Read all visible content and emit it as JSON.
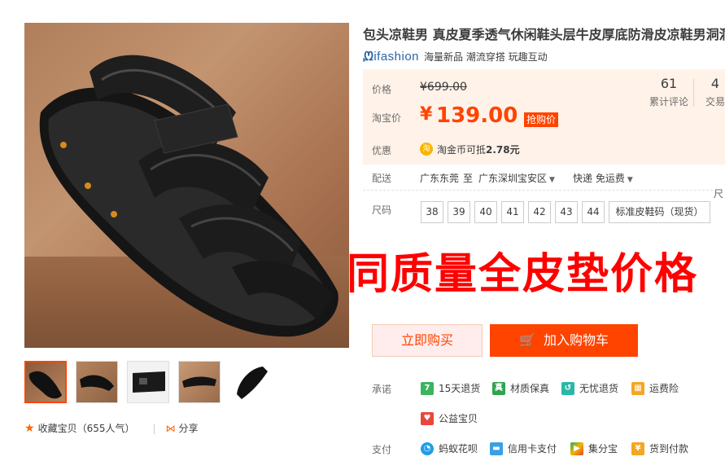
{
  "product": {
    "title": "包头凉鞋男 真皮夏季透气休闲鞋头层牛皮厚底防滑皮凉鞋男洞洞鞋",
    "brand_logo": "ifashion",
    "brand_tags": "海量新品 潮流穿搭 玩趣互动"
  },
  "price": {
    "orig_label": "价格",
    "orig_value": "¥699.00",
    "sale_label": "淘宝价",
    "sale_yen": "¥",
    "sale_value": "139.00",
    "badge": "抢购价",
    "stat1_num": "61",
    "stat1_label": "累计评论",
    "stat2_num": "4",
    "stat2_label": "交易",
    "promo_label": "优惠",
    "coin_icon": "淘",
    "coin_text": "淘金币可抵",
    "coin_value": "2.78元"
  },
  "shipping": {
    "label": "配送",
    "from": "广东东莞",
    "to_word": "至",
    "to": "广东深圳宝安区",
    "method": "快递 免运费",
    "right_fragment": "尺"
  },
  "sizes": {
    "label": "尺码",
    "items": [
      "38",
      "39",
      "40",
      "41",
      "42",
      "43",
      "44"
    ],
    "standard": "标准皮鞋码（现货）"
  },
  "promo_overlay": "同质量全皮垫价格",
  "buttons": {
    "buy": "立即购买",
    "cart": "加入购物车"
  },
  "promises": {
    "label": "承诺",
    "items": [
      "15天退货",
      "材质保真",
      "无忧退货",
      "运费险",
      "公益宝贝"
    ]
  },
  "payment": {
    "label": "支付",
    "items": [
      "蚂蚁花呗",
      "信用卡支付",
      "集分宝",
      "货到付款"
    ]
  },
  "footer": {
    "favorite": "收藏宝贝",
    "popularity": "（655人气）",
    "share": "分享"
  },
  "colors": {
    "accent": "#ff4400",
    "price_bg": "#fff2e8",
    "promo_text": "#ff0000"
  }
}
